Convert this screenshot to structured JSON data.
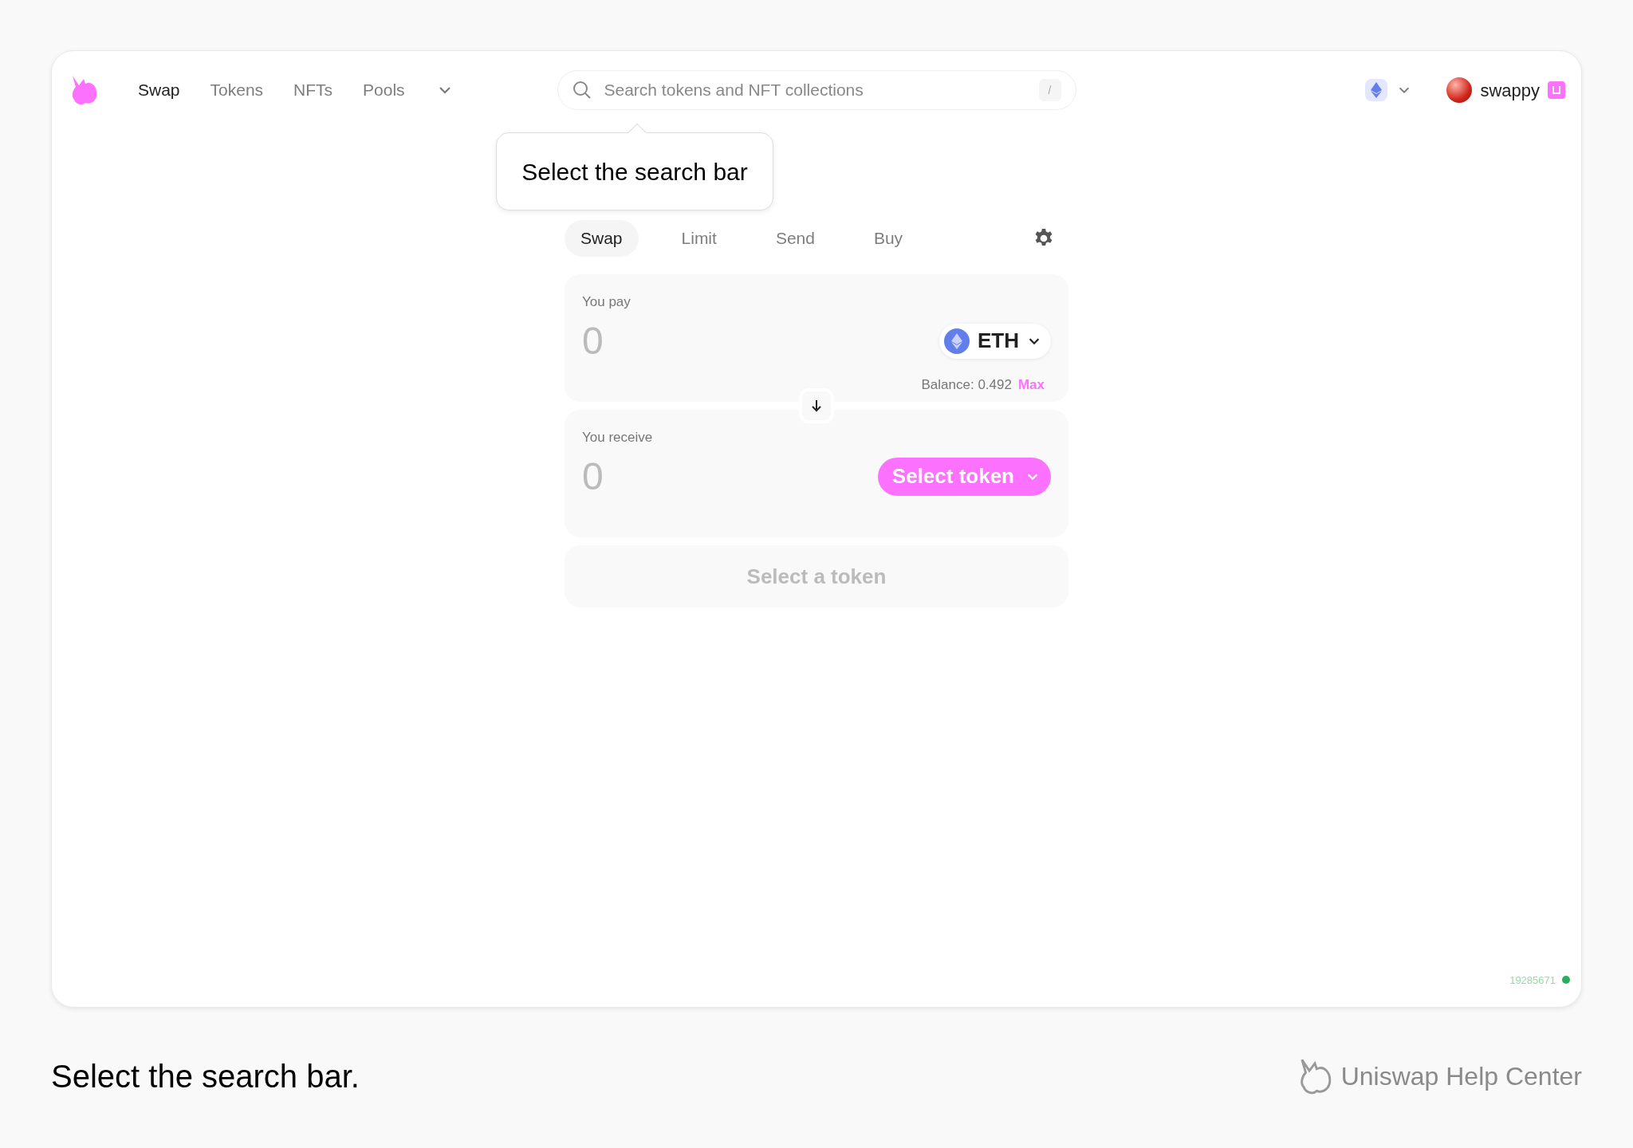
{
  "nav": {
    "items": [
      {
        "label": "Swap",
        "selected": true
      },
      {
        "label": "Tokens",
        "selected": false
      },
      {
        "label": "NFTs",
        "selected": false
      },
      {
        "label": "Pools",
        "selected": false
      }
    ]
  },
  "search": {
    "placeholder": "Search tokens and NFT collections",
    "shortcut": "/"
  },
  "account": {
    "name": "swappy"
  },
  "tooltip": {
    "text": "Select the search bar"
  },
  "swap_tabs": [
    {
      "label": "Swap",
      "selected": true
    },
    {
      "label": "Limit",
      "selected": false
    },
    {
      "label": "Send",
      "selected": false
    },
    {
      "label": "Buy",
      "selected": false
    }
  ],
  "pay": {
    "label": "You pay",
    "amount": "0",
    "token": "ETH",
    "balance": "Balance: 0.492",
    "max": "Max"
  },
  "receive": {
    "label": "You receive",
    "amount": "0",
    "token_button": "Select token"
  },
  "submit": {
    "label": "Select a token",
    "disabled": true
  },
  "block_number": "19285671",
  "caption": "Select the search bar.",
  "brand": "Uniswap Help Center"
}
